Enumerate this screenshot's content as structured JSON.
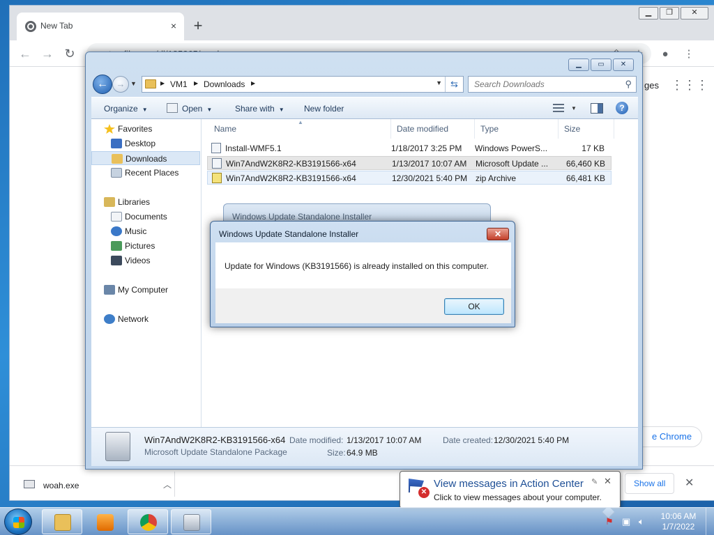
{
  "chrome": {
    "tab_title": "New Tab",
    "tab_close": "×",
    "new_tab": "+",
    "url": "tmpfiles.org/dl/185265/woah.exe",
    "ntp_images": "ges",
    "customize_label": "e Chrome",
    "download": {
      "filename": "woah.exe",
      "show_all": "Show all"
    }
  },
  "explorer": {
    "breadcrumbs": [
      "VM1",
      "Downloads"
    ],
    "search_placeholder": "Search Downloads",
    "commands": {
      "organize": "Organize",
      "open": "Open",
      "share_with": "Share with",
      "new_folder": "New folder"
    },
    "nav": {
      "favorites": "Favorites",
      "desktop": "Desktop",
      "downloads": "Downloads",
      "recent_places": "Recent Places",
      "libraries": "Libraries",
      "documents": "Documents",
      "music": "Music",
      "pictures": "Pictures",
      "videos": "Videos",
      "my_computer": "My Computer",
      "network": "Network"
    },
    "columns": [
      "Name",
      "Date modified",
      "Type",
      "Size"
    ],
    "files": [
      {
        "name": "Install-WMF5.1",
        "date": "1/18/2017 3:25 PM",
        "type": "Windows PowerS...",
        "size": "17 KB"
      },
      {
        "name": "Win7AndW2K8R2-KB3191566-x64",
        "date": "1/13/2017 10:07 AM",
        "type": "Microsoft Update ...",
        "size": "66,460 KB"
      },
      {
        "name": "Win7AndW2K8R2-KB3191566-x64",
        "date": "12/30/2021 5:40 PM",
        "type": "zip Archive",
        "size": "66,481 KB"
      }
    ],
    "details": {
      "name": "Win7AndW2K8R2-KB3191566-x64",
      "type": "Microsoft Update Standalone Package",
      "date_modified_label": "Date modified:",
      "date_modified": "1/13/2017 10:07 AM",
      "date_created_label": "Date created:",
      "date_created": "12/30/2021 5:40 PM",
      "size_label": "Size:",
      "size": "64.9 MB"
    }
  },
  "installer_bg_title": "Windows Update Standalone Installer",
  "dialog": {
    "title": "Windows Update Standalone Installer",
    "message": "Update for Windows (KB3191566) is already installed on this computer.",
    "ok": "OK"
  },
  "balloon": {
    "title": "View messages in Action Center",
    "text": "Click to view messages about your computer."
  },
  "taskbar": {
    "time": "10:06 AM",
    "date": "1/7/2022"
  }
}
